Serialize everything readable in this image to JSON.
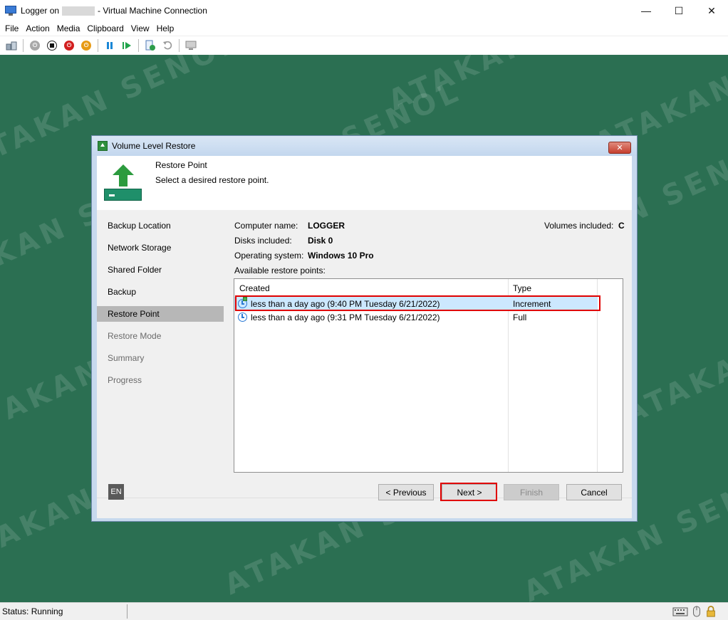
{
  "window": {
    "title_prefix": "Logger on",
    "title_suffix": "- Virtual Machine Connection",
    "minimize": "—",
    "maximize": "☐",
    "close": "✕"
  },
  "menu": [
    "File",
    "Action",
    "Media",
    "Clipboard",
    "View",
    "Help"
  ],
  "toolbar_icons": [
    "ctrl-alt-del-icon",
    "start-icon",
    "turn-off-icon",
    "shutdown-icon",
    "save-icon",
    "pause-icon",
    "resume-icon",
    "checkpoint-icon",
    "revert-icon",
    "enhanced-session-icon"
  ],
  "watermark": "ATAKAN SENOL",
  "dialog": {
    "title": "Volume Level Restore",
    "close": "✕",
    "header_title": "Restore Point",
    "header_subtitle": "Select a desired restore point.",
    "nav": [
      {
        "label": "Backup Location",
        "state": "done"
      },
      {
        "label": "Network Storage",
        "state": "done"
      },
      {
        "label": "Shared Folder",
        "state": "done"
      },
      {
        "label": "Backup",
        "state": "done"
      },
      {
        "label": "Restore Point",
        "state": "active"
      },
      {
        "label": "Restore Mode",
        "state": "disabled"
      },
      {
        "label": "Summary",
        "state": "disabled"
      },
      {
        "label": "Progress",
        "state": "disabled"
      }
    ],
    "info": {
      "computer_name_label": "Computer name:",
      "computer_name": "LOGGER",
      "disks_label": "Disks included:",
      "disks": "Disk 0",
      "os_label": "Operating system:",
      "os": "Windows 10 Pro",
      "volumes_label": "Volumes included:",
      "volumes": "C",
      "available_label": "Available restore points:"
    },
    "grid": {
      "columns": [
        "Created",
        "Type"
      ],
      "rows": [
        {
          "created": "less than a day ago (9:40 PM Tuesday 6/21/2022)",
          "type": "Increment",
          "selected": true
        },
        {
          "created": "less than a day ago (9:31 PM Tuesday 6/21/2022)",
          "type": "Full",
          "selected": false
        }
      ]
    },
    "language": "EN",
    "buttons": {
      "previous": "< Previous",
      "next": "Next >",
      "finish": "Finish",
      "cancel": "Cancel"
    }
  },
  "status": {
    "text": "Status: Running"
  },
  "colors": {
    "desktop": "#2b6f52",
    "highlight": "#e00000",
    "selected_row": "#cce8ff"
  }
}
